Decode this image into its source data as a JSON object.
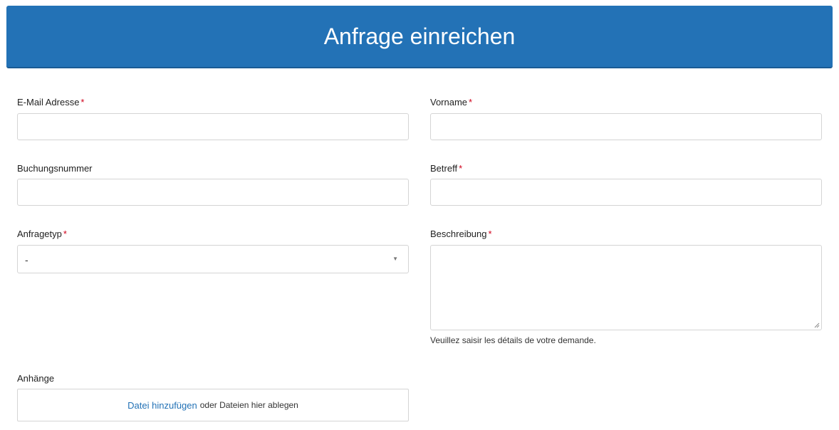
{
  "header": {
    "title": "Anfrage einreichen"
  },
  "form": {
    "email": {
      "label": "E-Mail Adresse",
      "required_mark": "*",
      "value": ""
    },
    "firstname": {
      "label": "Vorname",
      "required_mark": "*",
      "value": ""
    },
    "booking_number": {
      "label": "Buchungsnummer",
      "value": ""
    },
    "subject": {
      "label": "Betreff",
      "required_mark": "*",
      "value": ""
    },
    "request_type": {
      "label": "Anfragetyp",
      "required_mark": "*",
      "selected": "-",
      "arrow": "▼"
    },
    "description": {
      "label": "Beschreibung",
      "required_mark": "*",
      "value": "",
      "hint": "Veuillez saisir les détails de votre demande."
    },
    "attachments": {
      "label": "Anhänge",
      "add_link": "Datei hinzufügen",
      "drop_text": "oder Dateien hier ablegen"
    }
  },
  "colors": {
    "header_bg": "#2372b6",
    "required": "#d0021b",
    "link": "#2372b6",
    "border": "#d4d4d4"
  }
}
